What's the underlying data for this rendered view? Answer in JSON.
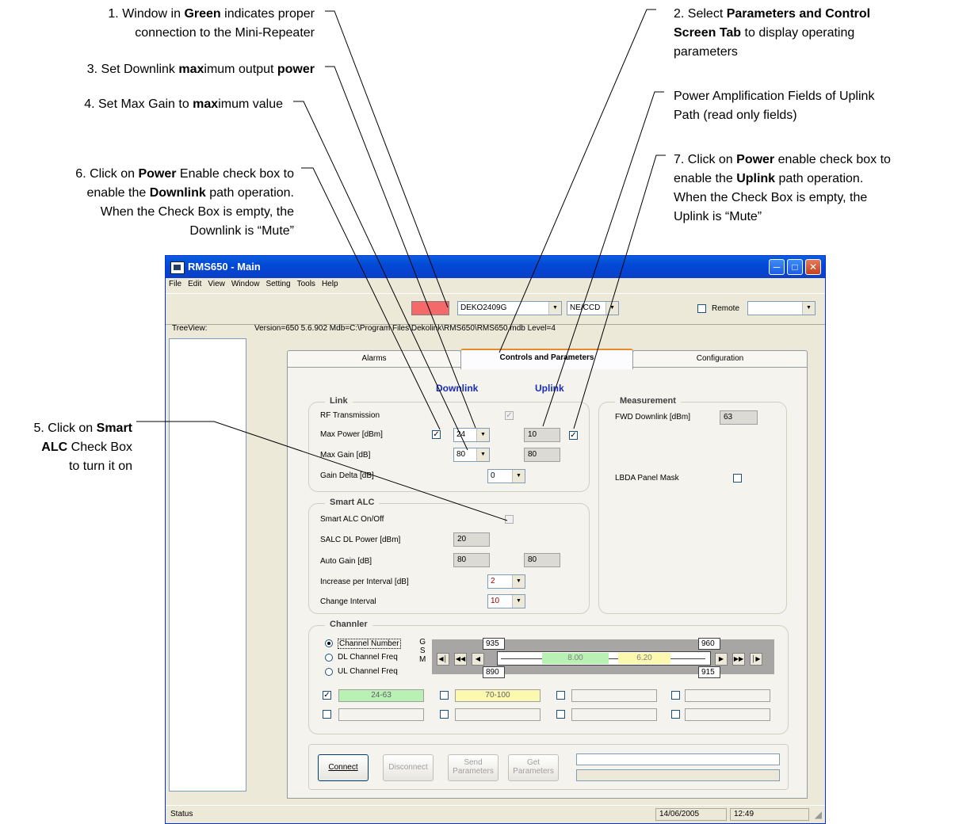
{
  "annotations": {
    "a1": {
      "l1_pre": "1. Window in ",
      "l1_b": "Green",
      "l1_post": " indicates proper",
      "l2": "connection to the Mini-Repeater"
    },
    "a3": {
      "pre": "3. Set Downlink ",
      "b1": "max",
      "mid": "imum output ",
      "b2": "power"
    },
    "a4": {
      "pre": "4. Set Max Gain to ",
      "b1": "max",
      "post": "imum value"
    },
    "a6": {
      "l1_pre": "6. Click on ",
      "l1_b": "Power",
      "l1_post": " Enable check box to",
      "l2_pre": "enable the ",
      "l2_b": "Downlink",
      "l2_post": " path operation.",
      "l3": "When the Check Box is empty, the",
      "l4": "Downlink is “Mute”"
    },
    "a5": {
      "l1_pre": "5. Click on ",
      "l1_b": "Smart",
      "l2_b": "ALC",
      "l2_post": " Check Box",
      "l3": "to turn it on"
    },
    "a2": {
      "l1_pre": "2. Select ",
      "l1_b": "Parameters and Control",
      "l2_b": "Screen Tab",
      "l2_post": " to display operating",
      "l3": "parameters"
    },
    "apa": {
      "l1": "Power Amplification Fields of  Uplink",
      "l2": "Path (read only fields)"
    },
    "a7": {
      "l1_pre": "7. Click on ",
      "l1_b": "Power",
      "l1_post": " enable check box to",
      "l2_pre": "enable the ",
      "l2_b": "Uplink",
      "l2_post": " path operation.",
      "l3": "When the Check Box is empty, the",
      "l4": "Uplink is “Mute”"
    }
  },
  "window": {
    "title": "RMS650 - Main",
    "menu": [
      "File",
      "Edit",
      "View",
      "Window",
      "Setting",
      "Tools",
      "Help"
    ],
    "connection_color": "#f46a6a",
    "device_select": "DEKO2409G",
    "mode_select": "NE/CCD",
    "remote_label": "Remote",
    "treeview_label": "TreeView:",
    "info": "Version=650 5.6.902   Mdb=C:\\Program Files\\Dekolink\\RMS650\\RMS650.mdb   Level=4",
    "tabs": [
      "Alarms",
      "Controls and Parameters",
      "Configuration"
    ],
    "active_tab": "Controls and Parameters"
  },
  "link": {
    "title": "Link",
    "downlink_head": "Downlink",
    "uplink_head": "Uplink",
    "rf_label": "RF Transmission",
    "max_power_label": "Max Power [dBm]",
    "max_power_dl": "24",
    "max_power_ul": "10",
    "max_gain_label": "Max Gain [dB]",
    "max_gain_dl": "80",
    "max_gain_ul": "80",
    "gain_delta_label": "Gain Delta [dB]",
    "gain_delta": "0"
  },
  "smart_alc": {
    "title": "Smart ALC",
    "onoff_label": "Smart ALC On/Off",
    "salc_label": "SALC DL Power [dBm]",
    "salc_value": "20",
    "auto_gain_label": "Auto Gain [dB]",
    "auto_gain_dl": "80",
    "auto_gain_ul": "80",
    "increase_label": "Increase per Interval [dB]",
    "increase_value": "2",
    "change_label": "Change Interval",
    "change_value": "10"
  },
  "measurement": {
    "title": "Measurement",
    "fwd_label": "FWD Downlink [dBm]",
    "fwd_value": "63",
    "lbda_label": "LBDA Panel Mask"
  },
  "channler": {
    "title": "Channler",
    "radios": [
      "Channel Number",
      "DL Channel Freq",
      "UL Channel Freq"
    ],
    "gsm_label": "G\nS\nM",
    "top_left": "935",
    "top_right": "960",
    "bottom_left": "890",
    "bottom_right": "915",
    "seg_green": "8.00",
    "seg_yellow": "6.20",
    "field1": "24-63",
    "field2": "70-100",
    "green": "#b9f0b4",
    "yellow": "#fbf8b0"
  },
  "buttons": {
    "connect": "Connect",
    "disconnect": "Disconnect",
    "send_1": "Send",
    "send_2": "Parameters",
    "get_1": "Get",
    "get_2": "Parameters"
  },
  "status": {
    "label": "Status",
    "date": "14/06/2005",
    "time": "12:49"
  }
}
